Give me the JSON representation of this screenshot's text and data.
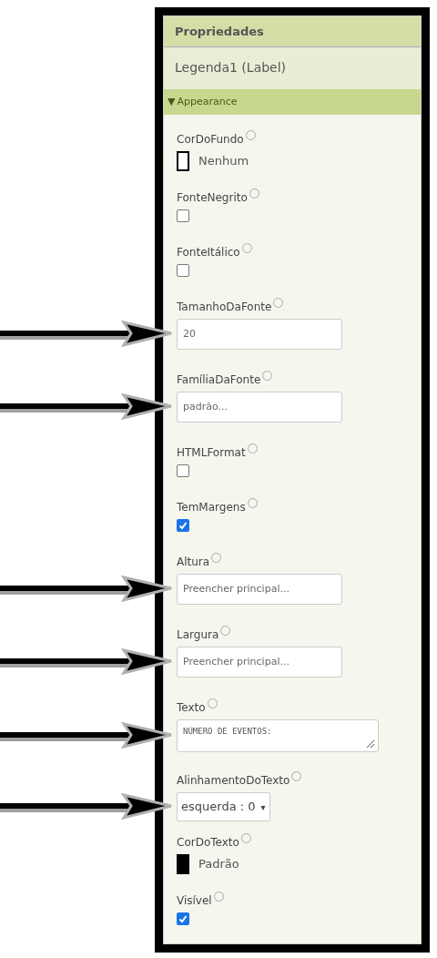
{
  "panel": {
    "title": "Propriedades",
    "component": "Legenda1 (Label)",
    "section": {
      "toggle": "▼",
      "label": "Appearance",
      "expanded": true
    },
    "properties": [
      {
        "kind": "color",
        "label": "CorDoFundo",
        "value": "Nenhum",
        "color": "#ffffff",
        "arrow": false
      },
      {
        "kind": "checkbox",
        "label": "FonteNegrito",
        "checked": false,
        "arrow": false
      },
      {
        "kind": "checkbox",
        "label": "FonteItálico",
        "checked": false,
        "arrow": false
      },
      {
        "kind": "text",
        "label": "TamanhoDaFonte",
        "value": "20",
        "arrow": true
      },
      {
        "kind": "text",
        "label": "FamíliaDaFonte",
        "value": "padrão...",
        "arrow": true
      },
      {
        "kind": "checkbox",
        "label": "HTMLFormat",
        "checked": false,
        "arrow": false
      },
      {
        "kind": "checkbox",
        "label": "TemMargens",
        "checked": true,
        "arrow": false
      },
      {
        "kind": "text",
        "label": "Altura",
        "value": "Preencher principal...",
        "arrow": true
      },
      {
        "kind": "text",
        "label": "Largura",
        "value": "Preencher principal...",
        "arrow": true
      },
      {
        "kind": "textarea",
        "label": "Texto",
        "value": "NÚMERO DE EVENTOS:",
        "arrow": true
      },
      {
        "kind": "select",
        "label": "AlinhamentoDoTexto",
        "value": "esquerda : 0",
        "caret": "▾",
        "arrow": true
      },
      {
        "kind": "color",
        "label": "CorDoTexto",
        "value": "Padrão",
        "color": "#000000",
        "arrow": false
      },
      {
        "kind": "checkbox",
        "label": "Visível",
        "checked": true,
        "arrow": false
      }
    ]
  }
}
